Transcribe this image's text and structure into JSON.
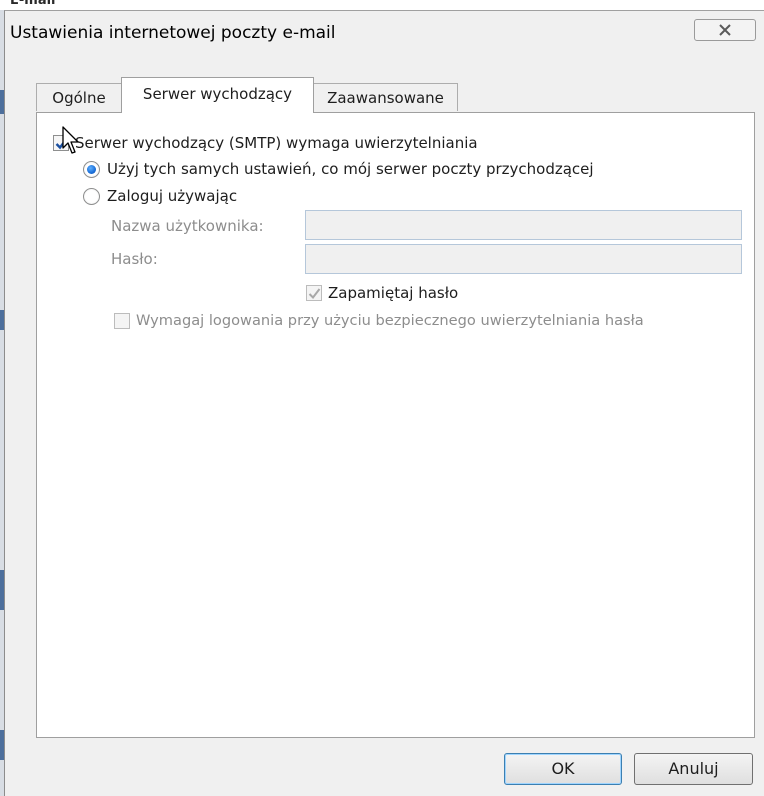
{
  "dialog": {
    "title": "Ustawienia internetowej poczty e-mail",
    "background_fragment": "E-mail"
  },
  "tabs": [
    {
      "label": "Ogólne",
      "active": false
    },
    {
      "label": "Serwer wychodzący",
      "active": true
    },
    {
      "label": "Zaawansowane",
      "active": false
    }
  ],
  "outgoing": {
    "smtp_auth_label": "Serwer wychodzący (SMTP) wymaga uwierzytelniania",
    "smtp_auth_checked": true,
    "use_same_label": "Użyj tych samych ustawień, co mój serwer poczty przychodzącej",
    "use_same_selected": true,
    "log_on_label": "Zaloguj używając",
    "log_on_selected": false,
    "username_label": "Nazwa użytkownika:",
    "username_value": "",
    "password_label": "Hasło:",
    "password_value": "",
    "remember_label": "Zapamiętaj hasło",
    "remember_checked": true,
    "spa_label": "Wymagaj logowania przy użyciu bezpiecznego uwierzytelniania hasła",
    "spa_checked": false
  },
  "buttons": {
    "ok": "OK",
    "cancel": "Anuluj"
  },
  "icons": {
    "close": "close-icon",
    "check": "check-icon",
    "cursor": "mouse-cursor-icon"
  },
  "colors": {
    "dialog_bg": "#f0f0f0",
    "panel_bg": "#ffffff",
    "check": "#1a4fa0",
    "radio_dot": "#1a6ed8",
    "disabled_text": "#8d8d8d",
    "default_button_border": "#3c7fb1"
  }
}
